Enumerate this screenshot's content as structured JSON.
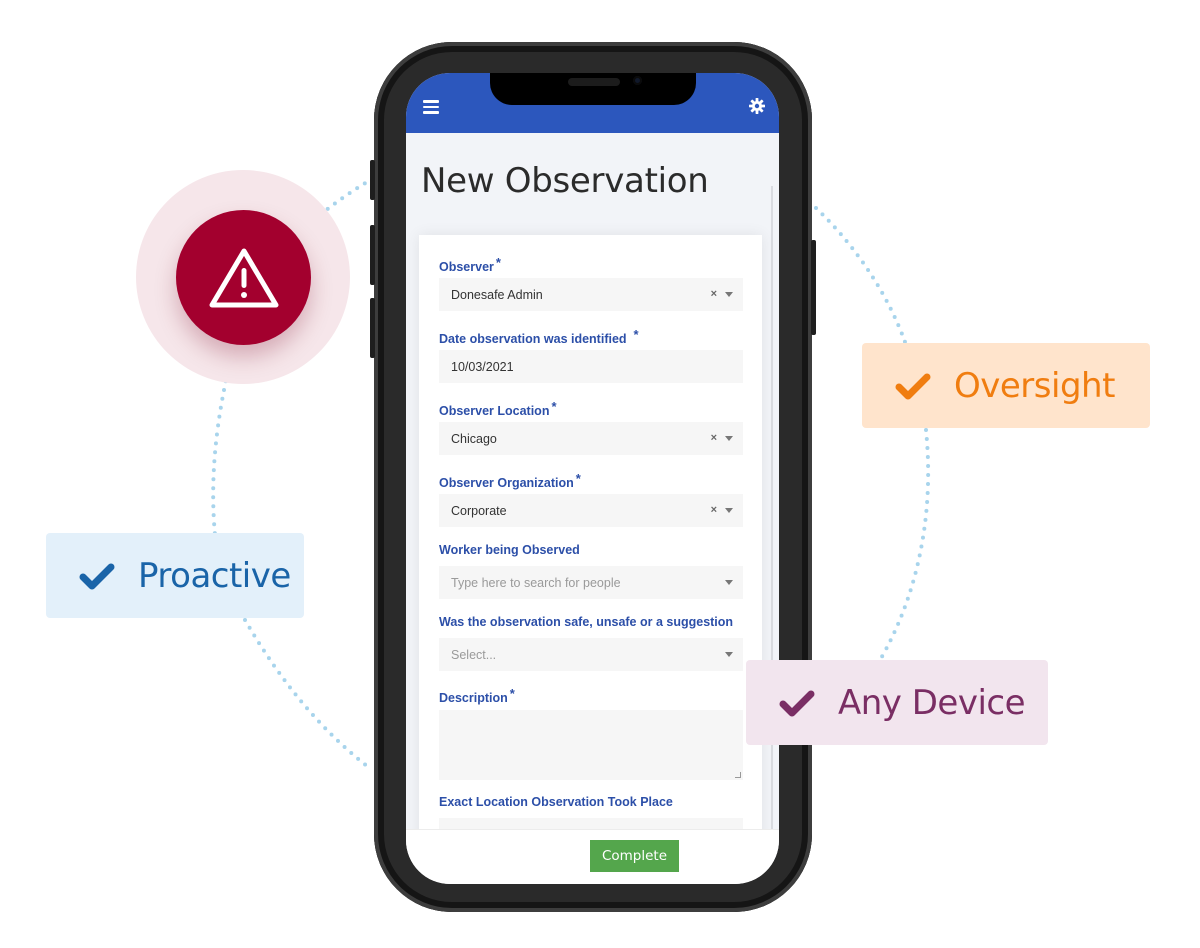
{
  "features": {
    "proactive": {
      "label": "Proactive",
      "icon": "check-icon",
      "color": "#1a64a8"
    },
    "oversight": {
      "label": "Oversight",
      "icon": "check-icon",
      "color": "#f07d10"
    },
    "any_device": {
      "label": "Any Device",
      "icon": "check-icon",
      "color": "#7a2e64"
    }
  },
  "alert": {
    "icon": "warning-triangle-icon",
    "color": "#a3002e"
  },
  "app": {
    "header": {
      "menu_icon": "hamburger-icon",
      "settings_icon": "gear-icon",
      "color": "#2c57bd"
    },
    "page_title": "New Observation",
    "form": {
      "required_marker": "*",
      "fields": [
        {
          "label": "Observer",
          "required": true,
          "value": "Donesafe Admin",
          "clearable": true
        },
        {
          "label": "Date observation was identified",
          "required": true,
          "value": "10/03/2021"
        },
        {
          "label": "Observer Location",
          "required": true,
          "value": "Chicago",
          "clearable": true
        },
        {
          "label": "Observer Organization",
          "required": true,
          "value": "Corporate",
          "clearable": true
        },
        {
          "label": "Worker being Observed",
          "required": false,
          "placeholder": "Type here to search for people"
        },
        {
          "label": "Was the observation safe, unsafe or a suggestion",
          "required": false,
          "placeholder": "Select..."
        },
        {
          "label": "Description",
          "required": true,
          "value": ""
        },
        {
          "label": "Exact Location Observation Took Place",
          "required": false,
          "value": ""
        }
      ],
      "clear_glyph": "×"
    },
    "footer": {
      "complete_label": "Complete",
      "complete_color": "#54a64c"
    }
  }
}
